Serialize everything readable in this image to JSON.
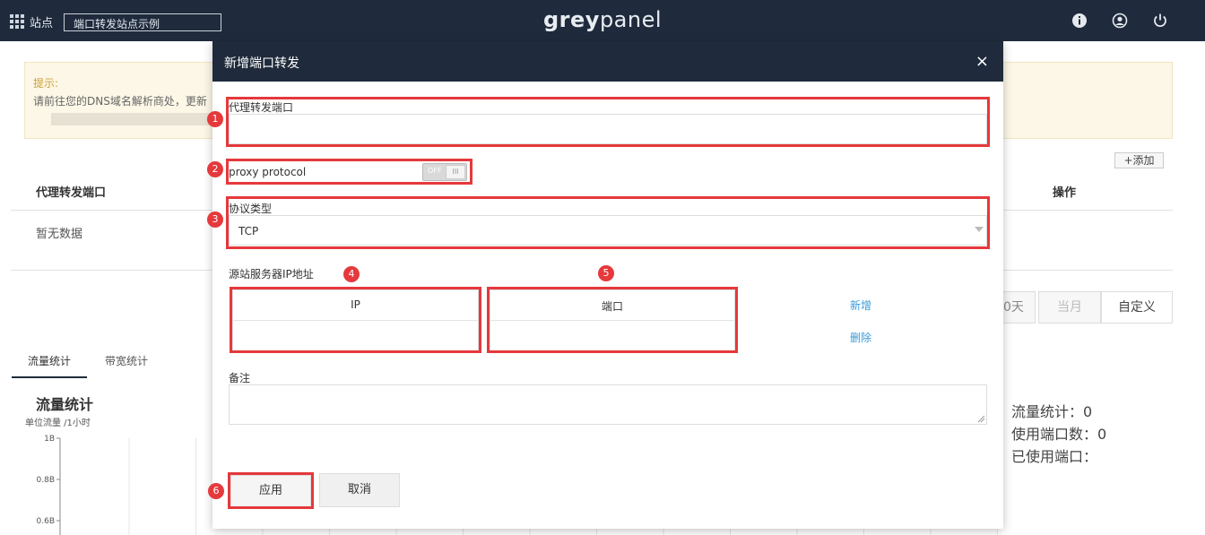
{
  "topbar": {
    "site_label": "站点",
    "site_value": "端口转发站点示例",
    "logo_bold": "grey",
    "logo_light": "panel",
    "icons": [
      "grid-icon",
      "info-icon",
      "user-icon",
      "power-icon"
    ]
  },
  "background": {
    "tip_title": "提示:",
    "tip_text": "请前往您的DNS域名解析商处，更新",
    "add_button": "+添加",
    "table_headers": {
      "proxy_port": "代理转发端口",
      "actions": "操作"
    },
    "empty_text": "暂无数据",
    "range_options": {
      "days": "0天",
      "month": "当月",
      "custom": "自定义"
    },
    "tabs": [
      "流量统计",
      "带宽统计"
    ],
    "chart_title": "流量统计",
    "chart_unit": "单位流量 /1小时",
    "stats": {
      "traffic": "流量统计：0",
      "ports_used_count": "使用端口数：0",
      "ports_used": "已使用端口："
    }
  },
  "chart_data": {
    "type": "line",
    "title": "流量统计",
    "ylabel": "单位流量 /1小时",
    "y_ticks": [
      "1B",
      "0.8B",
      "0.6B"
    ],
    "series": []
  },
  "modal": {
    "title": "新增端口转发",
    "close": "×",
    "proxy_port_label": "代理转发端口",
    "proxy_port_value": "",
    "proxy_protocol_label": "proxy protocol",
    "toggle_off": "OFF",
    "toggle_knob": "III",
    "protocol_label": "协议类型",
    "protocol_value": "TCP",
    "origin_label": "源站服务器IP地址",
    "ip_header": "IP",
    "port_header": "端口",
    "add_link": "新增",
    "delete_link": "删除",
    "note_label": "备注",
    "note_value": "",
    "apply_button": "应用",
    "cancel_button": "取消"
  },
  "markers": [
    "1",
    "2",
    "3",
    "4",
    "5",
    "6"
  ],
  "colors": {
    "header_bg": "#1f2b3c",
    "highlight_red": "#e5393c",
    "link_blue": "#3a9ad9"
  }
}
